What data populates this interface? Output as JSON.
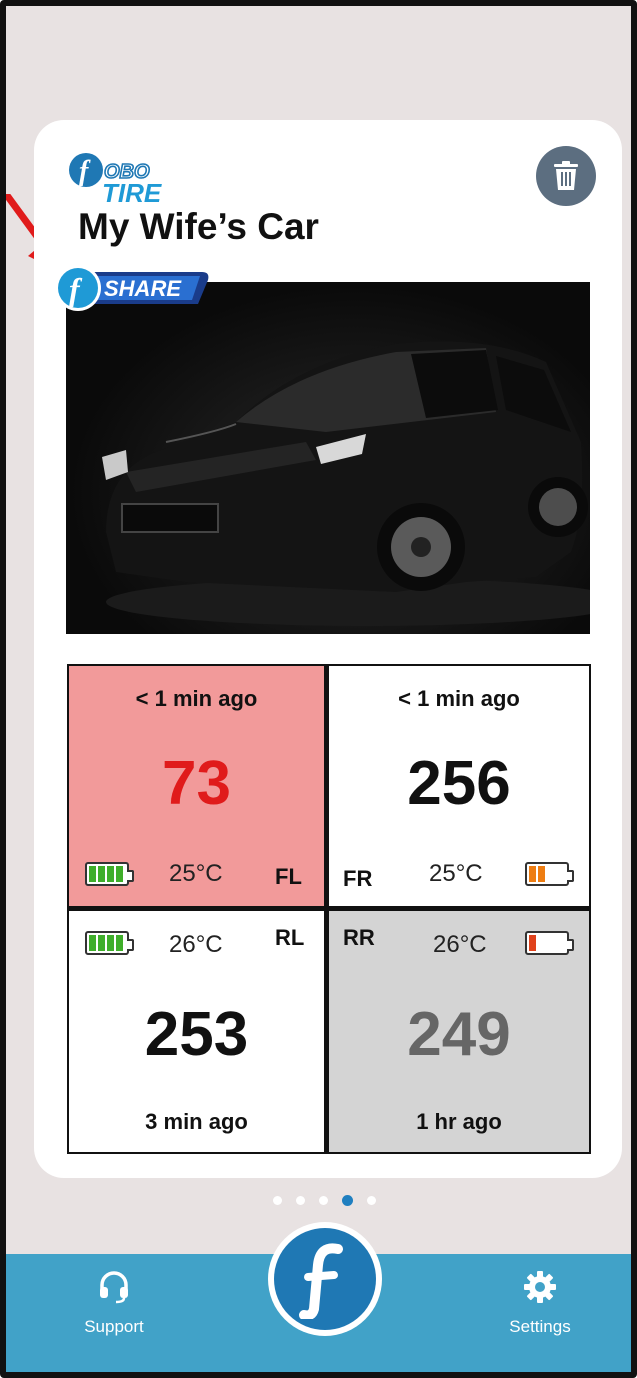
{
  "brand": {
    "logo_top": "OBO",
    "logo_bottom": "TIRE",
    "share_label": "SHARE"
  },
  "vehicle": {
    "name": "My Wife’s Car"
  },
  "tires": {
    "fl": {
      "position": "FL",
      "updated": "< 1 min ago",
      "value": "73",
      "temp": "25°C",
      "battery_color": "#3fae2a",
      "value_color": "#e01b1b",
      "bg": "#f29a9a"
    },
    "fr": {
      "position": "FR",
      "updated": "< 1 min ago",
      "value": "256",
      "temp": "25°C",
      "battery_color": "#ee7d12",
      "value_color": "#111111",
      "bg": "#ffffff"
    },
    "rl": {
      "position": "RL",
      "updated": "3 min ago",
      "value": "253",
      "temp": "26°C",
      "battery_color": "#3fae2a",
      "value_color": "#111111",
      "bg": "#ffffff"
    },
    "rr": {
      "position": "RR",
      "updated": "1 hr ago",
      "value": "249",
      "temp": "26°C",
      "battery_color": "#e0421c",
      "value_color": "#666666",
      "bg": "#d4d4d4"
    }
  },
  "pager": {
    "total": 5,
    "active": 4
  },
  "nav": {
    "support_label": "Support",
    "settings_label": "Settings"
  },
  "colors": {
    "accent": "#41a2c8",
    "brand_blue": "#1f78b4",
    "annotation": "#e01b1b"
  }
}
